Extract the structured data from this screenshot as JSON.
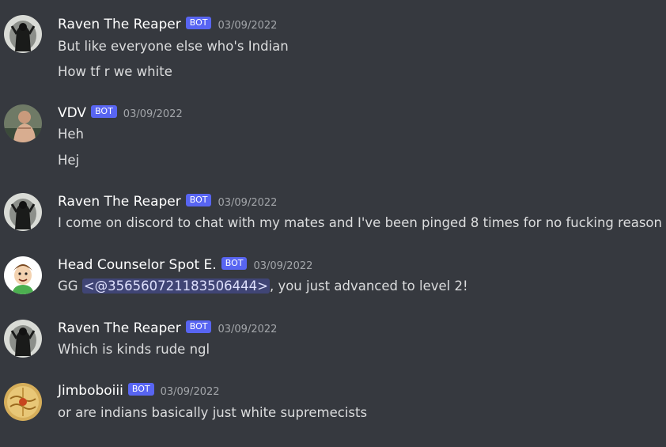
{
  "colors": {
    "background": "#36393f",
    "bot_tag": "#5865f2",
    "username": "#ffffff",
    "message_text": "#dcddde",
    "timestamp": "#a3a6aa",
    "mention_bg": "#5865f24d"
  },
  "messages": [
    {
      "username": "Raven The Reaper",
      "bot_tag": "BOT",
      "timestamp": "03/09/2022",
      "avatar_icon": "dark-figure-avatar",
      "lines": [
        "But like everyone else who's Indian",
        "How tf r we white"
      ]
    },
    {
      "username": "VDV",
      "bot_tag": "BOT",
      "timestamp": "03/09/2022",
      "avatar_icon": "person-photo-avatar",
      "lines": [
        "Heh",
        "Hej"
      ]
    },
    {
      "username": "Raven The Reaper",
      "bot_tag": "BOT",
      "timestamp": "03/09/2022",
      "avatar_icon": "dark-figure-avatar",
      "lines": [
        "I come on discord to chat with my mates and I've been pinged 8 times for no fucking reason"
      ]
    },
    {
      "username": "Head Counselor Spot E.",
      "bot_tag": "BOT",
      "timestamp": "03/09/2022",
      "avatar_icon": "cartoon-boy-avatar",
      "line_prefix": "GG ",
      "mention": "<@356560721183506444>",
      "line_suffix": ", you just advanced to level 2!"
    },
    {
      "username": "Raven The Reaper",
      "bot_tag": "BOT",
      "timestamp": "03/09/2022",
      "avatar_icon": "dark-figure-avatar",
      "lines": [
        "Which is kinds rude ngl"
      ]
    },
    {
      "username": "Jimboboiii",
      "bot_tag": "BOT",
      "timestamp": "03/09/2022",
      "avatar_icon": "golden-map-avatar",
      "lines": [
        "or are indians basically just white supremecists"
      ]
    }
  ]
}
